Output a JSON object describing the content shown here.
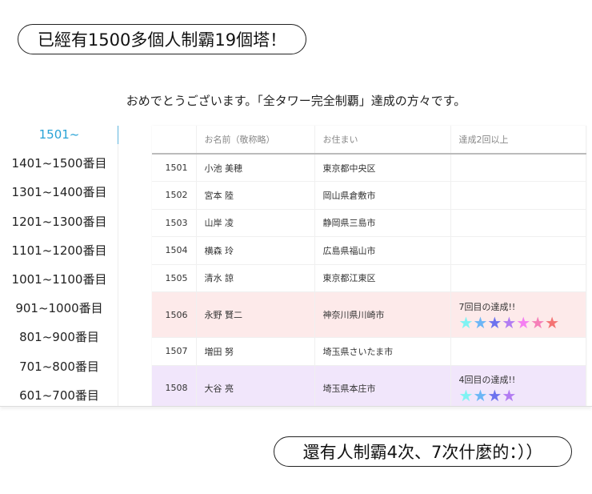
{
  "captions": {
    "top": "已經有1500多個人制霸19個塔！",
    "bottom": "還有人制霸4次、7次什麼的：））"
  },
  "headline": "おめでとうございます。「全タワー完全制覇」達成の方々です。",
  "sidebar": {
    "items": [
      "1501~",
      "1401~1500番目",
      "1301~1400番目",
      "1201~1300番目",
      "1101~1200番目",
      "1001~1100番目",
      "901~1000番目",
      "801~900番目",
      "701~800番目",
      "601~700番目"
    ]
  },
  "table": {
    "headers": [
      "",
      "お名前（敬称略）",
      "お住まい",
      "達成2回以上"
    ],
    "rows": [
      {
        "no": "1501",
        "name": "小池 美穂",
        "addr": "東京都中央区"
      },
      {
        "no": "1502",
        "name": "宮本 陸",
        "addr": "岡山県倉敷市"
      },
      {
        "no": "1503",
        "name": "山岸 凌",
        "addr": "静岡県三島市"
      },
      {
        "no": "1504",
        "name": "横森 玲",
        "addr": "広島県福山市"
      },
      {
        "no": "1505",
        "name": "清水 諒",
        "addr": "東京都江東区"
      },
      {
        "no": "1506",
        "name": "永野 賢二",
        "addr": "神奈川県川崎市",
        "times": "7回目の達成!!",
        "stars": 7
      },
      {
        "no": "1507",
        "name": "増田 努",
        "addr": "埼玉県さいたま市"
      },
      {
        "no": "1508",
        "name": "大谷 亮",
        "addr": "埼玉県本庄市",
        "times": "4回目の達成!!",
        "stars": 4
      }
    ]
  },
  "star_colors": [
    "#7ff3f3",
    "#6cb6f6",
    "#6c72ee",
    "#b27cf2",
    "#f57ff2",
    "#f57fb8",
    "#f47474"
  ],
  "row_colors": {
    "7": "pink",
    "4": "purple"
  }
}
